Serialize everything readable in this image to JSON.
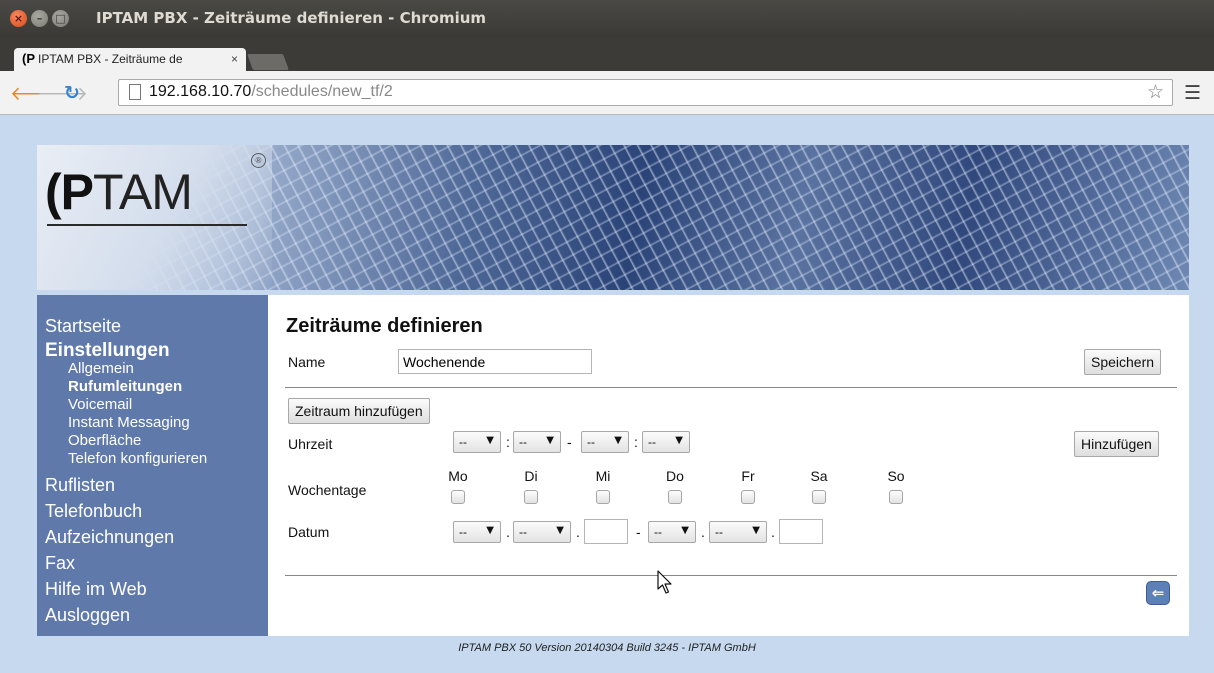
{
  "window": {
    "title": "IPTAM PBX - Zeiträume definieren - Chromium"
  },
  "tab": {
    "favicon": "(P",
    "label": "IPTAM PBX - Zeiträume de",
    "close": "×"
  },
  "address": {
    "host": "192.168.10.70",
    "path": "/schedules/new_tf/2"
  },
  "logo": {
    "brace": "(",
    "p": "P",
    "tam": "TAM",
    "reg": "®"
  },
  "sidebar": {
    "startseite": "Startseite",
    "einstellungen": "Einstellungen",
    "sub": [
      "Allgemein",
      "Rufumleitungen",
      "Voicemail",
      "Instant Messaging",
      "Oberfläche",
      "Telefon konfigurieren"
    ],
    "ruflisten": "Ruflisten",
    "telefonbuch": "Telefonbuch",
    "aufzeichnungen": "Aufzeichnungen",
    "fax": "Fax",
    "hilfe": "Hilfe im Web",
    "ausloggen": "Ausloggen"
  },
  "main": {
    "title": "Zeiträume definieren",
    "name_label": "Name",
    "name_value": "Wochenende",
    "save_button": "Speichern",
    "add_period_button": "Zeitraum hinzufügen",
    "time_label": "Uhrzeit",
    "add_button": "Hinzufügen",
    "weekdays_label": "Wochentage",
    "days": [
      "Mo",
      "Di",
      "Mi",
      "Do",
      "Fr",
      "Sa",
      "So"
    ],
    "date_label": "Datum",
    "select_placeholder": "--",
    "time_sep": ":",
    "range_sep": "-",
    "date_sep": "."
  },
  "footer": "IPTAM PBX 50 Version 20140304 Build 3245 - IPTAM GmbH",
  "icons": {
    "close": "close-icon",
    "back": "back-arrow-icon",
    "forward": "forward-arrow-icon",
    "reload": "reload-icon",
    "star": "star-icon",
    "menu": "menu-icon",
    "return": "return-arrow-icon"
  },
  "colors": {
    "sidebar": "#5f79ab",
    "page_bg": "#c6d9ef"
  }
}
